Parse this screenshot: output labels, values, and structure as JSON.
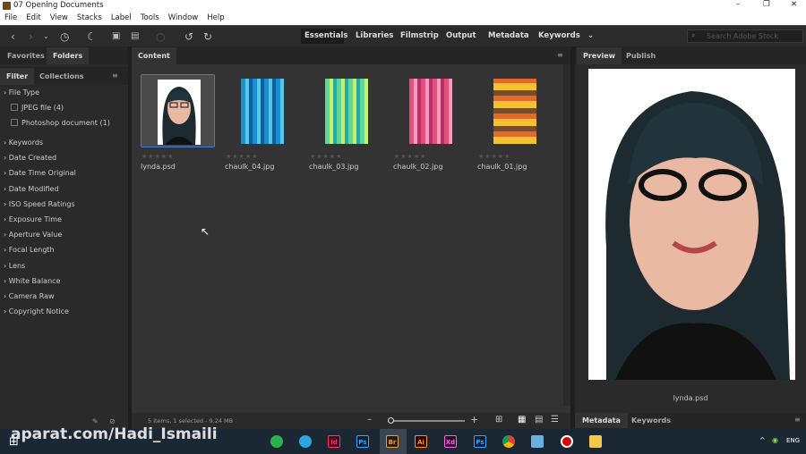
{
  "window": {
    "title": "07 Opening Documents",
    "minimize": "–",
    "restore": "❐",
    "close": "✕"
  },
  "menu": [
    "File",
    "Edit",
    "View",
    "Stacks",
    "Label",
    "Tools",
    "Window",
    "Help"
  ],
  "workspaces": [
    "Essentials",
    "Libraries",
    "Filmstrip",
    "Output",
    "Metadata",
    "Keywords"
  ],
  "active_workspace": "Essentials",
  "search": {
    "placeholder": "Search Adobe Stock"
  },
  "left_tabs": {
    "favorites": "Favorites",
    "folders": "Folders",
    "filter": "Filter",
    "collections": "Collections"
  },
  "filter": {
    "file_type": "File Type",
    "file_type_items": [
      "JPEG file (4)",
      "Photoshop document (1)"
    ],
    "categories": [
      "Keywords",
      "Date Created",
      "Date Time Original",
      "Date Modified",
      "ISO Speed Ratings",
      "Exposure Time",
      "Aperture Value",
      "Focal Length",
      "Lens",
      "White Balance",
      "Camera Raw",
      "Copyright Notice"
    ]
  },
  "content": {
    "tab": "Content",
    "items": [
      {
        "name": "lynda.psd",
        "selected": true
      },
      {
        "name": "chaulk_04.jpg"
      },
      {
        "name": "chaulk_03.jpg"
      },
      {
        "name": "chaulk_02.jpg"
      },
      {
        "name": "chaulk_01.jpg"
      }
    ],
    "status": "5 items, 1 selected - 9.24 MB",
    "rating_stars": "★★★★★"
  },
  "preview": {
    "tabs": [
      "Preview",
      "Publish"
    ],
    "filename": "lynda.psd"
  },
  "bottom_tabs": [
    "Metadata",
    "Keywords"
  ],
  "taskbar": {
    "watermark": "aparat.com/Hadi_Ismaili",
    "lang": "ENG",
    "apps": [
      "Id",
      "Ps",
      "Br",
      "Ai",
      "Xd",
      "Ps"
    ]
  },
  "colors": {
    "accent": "#3b7ed8",
    "panel": "#2a2a2a",
    "bridge": "#e8a33c"
  }
}
